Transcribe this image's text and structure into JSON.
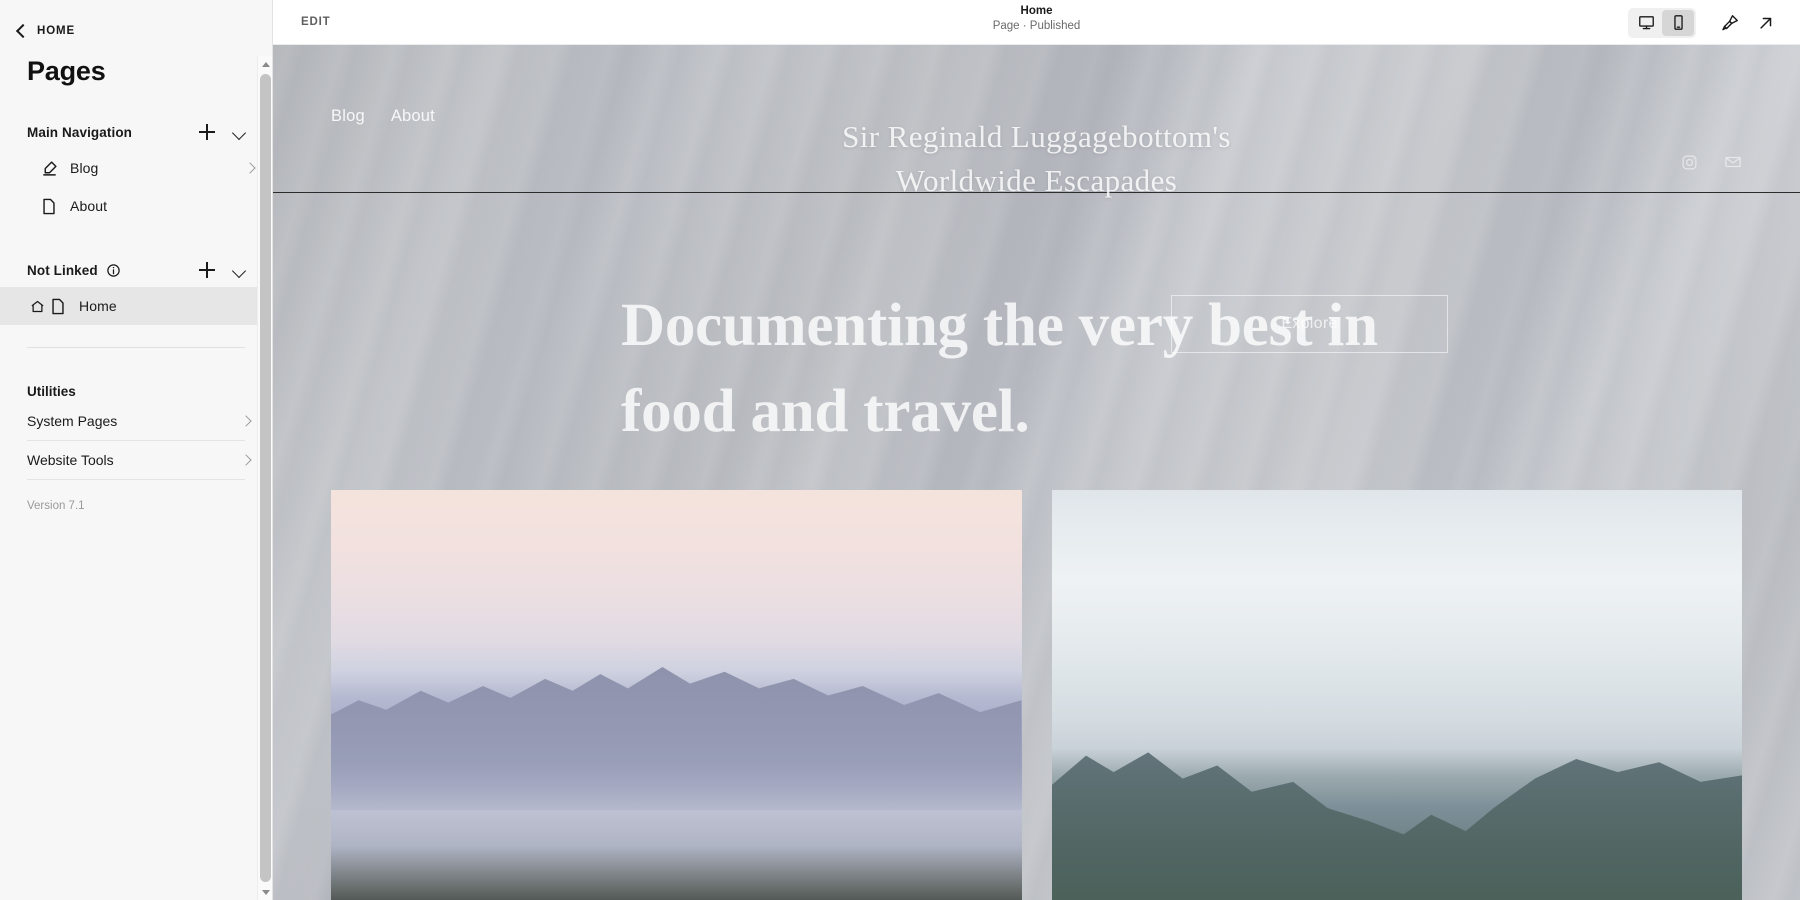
{
  "sidebar": {
    "back_label": "HOME",
    "title": "Pages",
    "sections": [
      {
        "label": "Main Navigation",
        "has_info": false,
        "items": [
          {
            "label": "Blog",
            "icon": "blog-pen-icon",
            "has_chevron": true,
            "selected": false
          },
          {
            "label": "About",
            "icon": "page-icon",
            "has_chevron": false,
            "selected": false
          }
        ]
      },
      {
        "label": "Not Linked",
        "has_info": true,
        "items": [
          {
            "label": "Home",
            "icon": "page-icon",
            "home_icon": "house-icon",
            "has_chevron": false,
            "selected": true
          }
        ]
      }
    ],
    "utilities": {
      "heading": "Utilities",
      "items": [
        {
          "label": "System Pages"
        },
        {
          "label": "Website Tools"
        }
      ]
    },
    "version": "Version 7.1"
  },
  "toolbar": {
    "edit_label": "EDIT",
    "page_title": "Home",
    "page_status": "Page · Published",
    "view_buttons": [
      {
        "name": "desktop-view",
        "active": false
      },
      {
        "name": "mobile-view",
        "active": true
      }
    ],
    "style_icon": "paintbrush-icon",
    "open_icon": "external-link-icon"
  },
  "preview": {
    "nav": [
      {
        "label": "Blog"
      },
      {
        "label": "About"
      }
    ],
    "site_title_line1": "Sir Reginald Luggagebottom's",
    "site_title_line2": "Worldwide Escapades",
    "social": [
      {
        "name": "instagram-icon"
      },
      {
        "name": "email-icon"
      }
    ],
    "hero_heading_line1": "Documenting the very best in",
    "hero_heading_line2": "food and travel.",
    "hero_button_label": "Explore",
    "gallery": [
      {
        "name": "lake-mountains-sunset-photo"
      },
      {
        "name": "valley-mountains-clouds-photo"
      }
    ]
  },
  "colors": {
    "sidebar_bg": "#f7f7f7",
    "selected_row_bg": "#e6e6e6",
    "text_primary": "#1a1a1a",
    "text_muted": "#6a6a6a",
    "preview_overlay": "#b7b9bc"
  }
}
